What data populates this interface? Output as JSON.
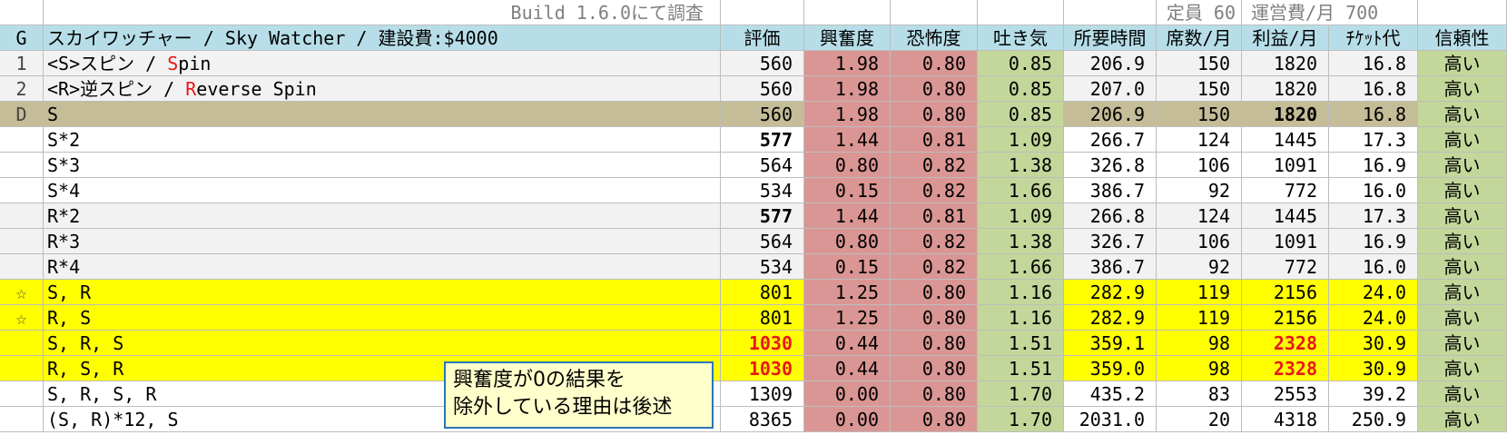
{
  "top": {
    "build": "Build 1.6.0にて調査",
    "capacity": "定員 60",
    "running_cost": "運営費/月 700"
  },
  "header": {
    "g": "G",
    "name": "スカイワッチャー / Sky Watcher / 建設費:$4000",
    "rating": "評価",
    "excitement": "興奮度",
    "fear": "恐怖度",
    "nausea": "吐き気",
    "time": "所要時間",
    "seats": "席数/月",
    "profit": "利益/月",
    "ticket": "ﾁｹｯﾄ代",
    "reliability": "信頼性"
  },
  "rows": [
    {
      "g": "1",
      "name_pre": "<S>スピン   / ",
      "name_red": "S",
      "name_post": "pin",
      "rating": "560",
      "excitement": "1.98",
      "fear": "0.80",
      "nausea": "0.85",
      "time": "206.9",
      "seats": "150",
      "profit": "1820",
      "ticket": "16.8",
      "reliability": "高い",
      "bg": "gray"
    },
    {
      "g": "2",
      "name_pre": "<R>逆スピン / ",
      "name_red": "R",
      "name_post": "everse Spin",
      "rating": "560",
      "excitement": "1.98",
      "fear": "0.80",
      "nausea": "0.85",
      "time": "207.0",
      "seats": "150",
      "profit": "1820",
      "ticket": "16.8",
      "reliability": "高い",
      "bg": "gray"
    },
    {
      "g": "D",
      "name_pre": "S",
      "name_red": "",
      "name_post": "",
      "rating": "560",
      "excitement": "1.98",
      "fear": "0.80",
      "nausea": "0.85",
      "time": "206.9",
      "seats": "150",
      "profit": "1820",
      "ticket": "16.8",
      "reliability": "高い",
      "bg": "tan",
      "profit_bold": true
    },
    {
      "g": "",
      "name_pre": "S*2",
      "name_red": "",
      "name_post": "",
      "rating": "577",
      "excitement": "1.44",
      "fear": "0.81",
      "nausea": "1.09",
      "time": "266.7",
      "seats": "124",
      "profit": "1445",
      "ticket": "17.3",
      "reliability": "高い",
      "bg": "white",
      "rating_bold": true
    },
    {
      "g": "",
      "name_pre": "S*3",
      "name_red": "",
      "name_post": "",
      "rating": "564",
      "excitement": "0.80",
      "fear": "0.82",
      "nausea": "1.38",
      "time": "326.8",
      "seats": "106",
      "profit": "1091",
      "ticket": "16.9",
      "reliability": "高い",
      "bg": "white"
    },
    {
      "g": "",
      "name_pre": "S*4",
      "name_red": "",
      "name_post": "",
      "rating": "534",
      "excitement": "0.15",
      "fear": "0.82",
      "nausea": "1.66",
      "time": "386.7",
      "seats": "92",
      "profit": "772",
      "ticket": "16.0",
      "reliability": "高い",
      "bg": "white"
    },
    {
      "g": "",
      "name_pre": "R*2",
      "name_red": "",
      "name_post": "",
      "rating": "577",
      "excitement": "1.44",
      "fear": "0.81",
      "nausea": "1.09",
      "time": "266.8",
      "seats": "124",
      "profit": "1445",
      "ticket": "17.3",
      "reliability": "高い",
      "bg": "gray",
      "rating_bold": true
    },
    {
      "g": "",
      "name_pre": "R*3",
      "name_red": "",
      "name_post": "",
      "rating": "564",
      "excitement": "0.80",
      "fear": "0.82",
      "nausea": "1.38",
      "time": "326.7",
      "seats": "106",
      "profit": "1091",
      "ticket": "16.9",
      "reliability": "高い",
      "bg": "gray"
    },
    {
      "g": "",
      "name_pre": "R*4",
      "name_red": "",
      "name_post": "",
      "rating": "534",
      "excitement": "0.15",
      "fear": "0.82",
      "nausea": "1.66",
      "time": "386.7",
      "seats": "92",
      "profit": "772",
      "ticket": "16.0",
      "reliability": "高い",
      "bg": "gray"
    },
    {
      "g": "☆",
      "name_pre": "S, R",
      "name_red": "",
      "name_post": "",
      "rating": "801",
      "excitement": "1.25",
      "fear": "0.80",
      "nausea": "1.16",
      "time": "282.9",
      "seats": "119",
      "profit": "2156",
      "ticket": "24.0",
      "reliability": "高い",
      "bg": "yellow"
    },
    {
      "g": "☆",
      "name_pre": "R, S",
      "name_red": "",
      "name_post": "",
      "rating": "801",
      "excitement": "1.25",
      "fear": "0.80",
      "nausea": "1.16",
      "time": "282.9",
      "seats": "119",
      "profit": "2156",
      "ticket": "24.0",
      "reliability": "高い",
      "bg": "yellow"
    },
    {
      "g": "",
      "name_pre": "S, R, S",
      "name_red": "",
      "name_post": "",
      "rating": "1030",
      "excitement": "0.44",
      "fear": "0.80",
      "nausea": "1.51",
      "time": "359.1",
      "seats": "98",
      "profit": "2328",
      "ticket": "30.9",
      "reliability": "高い",
      "bg": "yellow",
      "rating_redbold": true,
      "profit_redbold": true
    },
    {
      "g": "",
      "name_pre": "R, S, R",
      "name_red": "",
      "name_post": "",
      "rating": "1030",
      "excitement": "0.44",
      "fear": "0.80",
      "nausea": "1.51",
      "time": "359.0",
      "seats": "98",
      "profit": "2328",
      "ticket": "30.9",
      "reliability": "高い",
      "bg": "yellow",
      "rating_redbold": true,
      "profit_redbold": true
    },
    {
      "g": "",
      "name_pre": "S, R, S, R",
      "name_red": "",
      "name_post": "",
      "rating": "1309",
      "excitement": "0.00",
      "fear": "0.80",
      "nausea": "1.70",
      "time": "435.2",
      "seats": "83",
      "profit": "2553",
      "ticket": "39.2",
      "reliability": "高い",
      "bg": "white"
    },
    {
      "g": "",
      "name_pre": "(S, R)*12, S",
      "name_red": "",
      "name_post": "",
      "rating": "8365",
      "excitement": "0.00",
      "fear": "0.80",
      "nausea": "1.70",
      "time": "2031.0",
      "seats": "20",
      "profit": "4318",
      "ticket": "250.9",
      "reliability": "高い",
      "bg": "white"
    }
  ],
  "note": {
    "line1": "興奮度が0の結果を",
    "line2": "除外している理由は後述"
  },
  "colors": {
    "header_bg": "#b7dee8",
    "excitement_bg": "#da9694",
    "nausea_bg": "#c4d79b",
    "highlight_yellow": "#ffff00",
    "default_row_tan": "#c4bd97",
    "accent_red": "#e8181a"
  }
}
